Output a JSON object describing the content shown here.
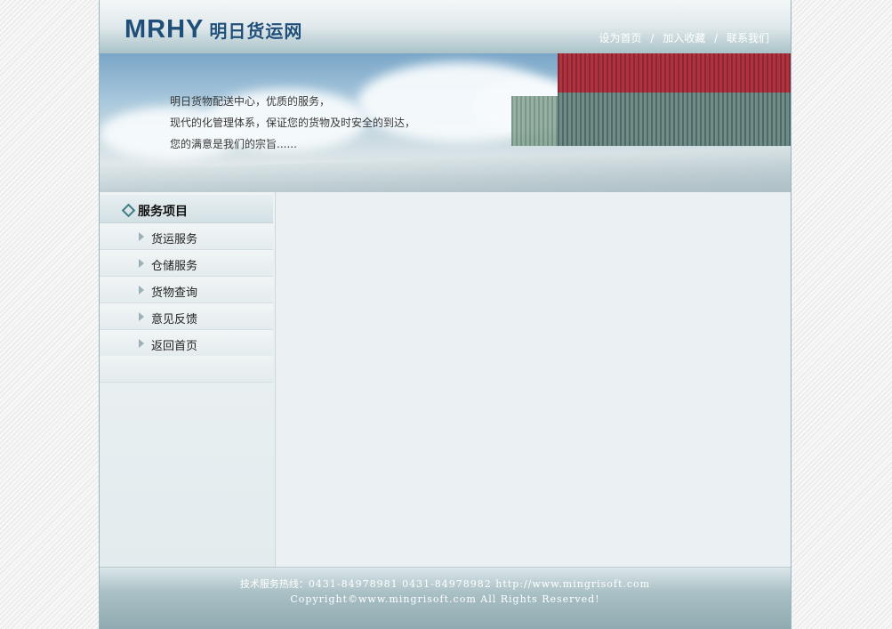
{
  "header": {
    "logo_en": "MRHY",
    "logo_cn": "明日货运网",
    "links": [
      {
        "label": "设为首页"
      },
      {
        "label": "加入收藏"
      },
      {
        "label": "联系我们"
      }
    ],
    "separator": "/"
  },
  "banner": {
    "slogan_lines": [
      "明日货物配送中心，优质的服务，",
      "现代的化管理体系，保证您的货物及时安全的到达，",
      "您的满意是我们的宗旨......"
    ]
  },
  "sidebar": {
    "title": "服务项目",
    "items": [
      {
        "label": "货运服务"
      },
      {
        "label": "仓储服务"
      },
      {
        "label": "货物查询"
      },
      {
        "label": "意见反馈"
      },
      {
        "label": "返回首页"
      }
    ]
  },
  "footer": {
    "hotline_label": "技术服务热线：",
    "hotline_numbers": "0431-84978981  0431-84978982 http://www.mingrisoft.com",
    "copyright": "Copyright©www.mingrisoft.com All Rights Reserved!"
  },
  "colors": {
    "logo": "#1f4f78",
    "footer_text": "#ffffff",
    "sidebar_arrow": "#9bb0b7"
  }
}
